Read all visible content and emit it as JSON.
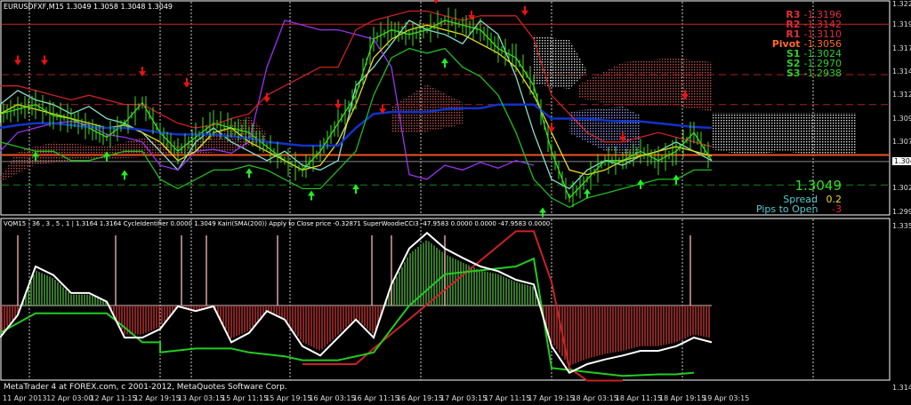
{
  "header": {
    "symbol_info": "EURUSDFXF,M15  1.3049 1.3058 1.3048 1.3049",
    "indicator_info": "VQM15 : 36 , 3 , 5 , 1  |  1.3164 1.3164  CycleIdentifier 0.0000 1.3049  Kairi(SMA(200)) Apply to Close price -0.32871  SuperWoodieCCI3 -47.9583 0.0000 0.0000 -47.9583 0.0000"
  },
  "pivots": [
    {
      "name": "R3",
      "value": "-1.3196",
      "color": "#e0303a"
    },
    {
      "name": "R2",
      "value": "-1.3142",
      "color": "#e0303a"
    },
    {
      "name": "R1",
      "value": "-1.3110",
      "color": "#e0303a"
    },
    {
      "name": "Pivot",
      "value": "-1.3056",
      "color": "#ff6a2a"
    },
    {
      "name": "S1",
      "value": "-1.3024",
      "color": "#2ecc2e"
    },
    {
      "name": "S2",
      "value": "-1.2970",
      "color": "#2ecc2e"
    },
    {
      "name": "S3",
      "value": "-1.2938",
      "color": "#2ecc2e"
    }
  ],
  "info_panel": {
    "price": "1.3049",
    "spread_label": "Spread",
    "spread_value": "0.2",
    "pips_label": "Pips to Open",
    "pips_value": "-3"
  },
  "footer": {
    "copyright": "MetaTrader 4 at FOREX.com, c 2001-2012, MetaQuotes Software Corp."
  },
  "chart_data": [
    {
      "type": "line",
      "title": "EURUSDFXF,M15",
      "ylim": [
        1.2995,
        1.322
      ],
      "y_ticks": [
        "1.3220",
        "1.3195",
        "1.3170",
        "1.3145",
        "1.3120",
        "1.3095",
        "1.3070",
        "1.3049",
        "1.3020",
        "1.2995"
      ],
      "current_price": 1.3049,
      "levels": {
        "R3": 1.3196,
        "R2": 1.3142,
        "R1": 1.311,
        "Pivot": 1.3056,
        "S1": 1.3024
      },
      "series": [
        {
          "name": "price",
          "color": "#33dd22",
          "values": [
            1.31,
            1.3105,
            1.311,
            1.3098,
            1.3095,
            1.3085,
            1.3075,
            1.309,
            1.3112,
            1.308,
            1.306,
            1.3075,
            1.309,
            1.3085,
            1.308,
            1.3065,
            1.305,
            1.304,
            1.306,
            1.309,
            1.312,
            1.318,
            1.319,
            1.3185,
            1.319,
            1.32,
            1.3195,
            1.319,
            1.317,
            1.316,
            1.313,
            1.306,
            1.301,
            1.303,
            1.305,
            1.305,
            1.306,
            1.305,
            1.306,
            1.308,
            1.305
          ]
        },
        {
          "name": "cyan",
          "color": "#88e0d0",
          "values": [
            1.311,
            1.3125,
            1.3115,
            1.311,
            1.31,
            1.3108,
            1.3095,
            1.309,
            1.308,
            1.306,
            1.304,
            1.307,
            1.3085,
            1.307,
            1.306,
            1.305,
            1.306,
            1.3045,
            1.304,
            1.305,
            1.313,
            1.315,
            1.3175,
            1.32,
            1.319,
            1.3185,
            1.3175,
            1.32,
            1.3185,
            1.314,
            1.308,
            1.303,
            1.302,
            1.304,
            1.305,
            1.3045,
            1.3055,
            1.306,
            1.307,
            1.306,
            1.305
          ]
        },
        {
          "name": "purple",
          "color": "#9933ee",
          "values": [
            1.306,
            1.308,
            1.3085,
            1.309,
            1.3092,
            1.3088,
            1.3078,
            1.3075,
            1.307,
            1.3045,
            1.304,
            1.306,
            1.3062,
            1.3058,
            1.307,
            1.315,
            1.32,
            1.3195,
            1.319,
            1.319,
            1.3185,
            1.318,
            1.315,
            1.3035,
            1.303,
            1.3045,
            1.304,
            1.3048,
            1.3042,
            1.305,
            1.3045,
            null,
            null,
            null,
            null,
            null,
            null,
            null,
            null,
            null,
            null
          ]
        },
        {
          "name": "yellow",
          "color": "#eedd22",
          "values": [
            1.31,
            1.311,
            1.3105,
            1.31,
            1.3095,
            1.309,
            1.3085,
            1.3088,
            1.308,
            1.307,
            1.305,
            1.306,
            1.308,
            1.3085,
            1.307,
            1.306,
            1.305,
            1.304,
            1.3045,
            1.307,
            1.311,
            1.316,
            1.318,
            1.319,
            1.3195,
            1.319,
            1.3185,
            1.3175,
            1.3165,
            1.315,
            1.312,
            1.308,
            1.304,
            1.3035,
            1.304,
            1.305,
            1.3055,
            1.306,
            1.3065,
            1.306,
            1.3055
          ]
        },
        {
          "name": "blue",
          "color": "#1133cc",
          "values": [
            1.3085,
            1.3088,
            1.309,
            1.309,
            1.3088,
            1.3086,
            1.3085,
            1.3085,
            1.3083,
            1.308,
            1.3078,
            1.3078,
            1.3078,
            1.3076,
            1.3074,
            1.307,
            1.3068,
            1.3066,
            1.3066,
            1.3066,
            1.3085,
            1.31,
            1.3102,
            1.3102,
            1.3102,
            1.3105,
            1.3106,
            1.3106,
            1.311,
            1.311,
            1.311,
            1.3095,
            1.3095,
            1.3095,
            1.3093,
            1.3092,
            1.3092,
            1.309,
            1.3088,
            1.3086,
            1.3085
          ]
        },
        {
          "name": "red-channel",
          "color": "#cc2222",
          "values": [
            1.313,
            1.313,
            1.3125,
            1.312,
            1.3115,
            1.312,
            1.3115,
            1.311,
            1.311,
            1.31,
            1.309,
            1.3085,
            1.3088,
            1.3095,
            1.31,
            1.312,
            1.313,
            1.314,
            1.315,
            1.315,
            1.319,
            1.32,
            1.3205,
            1.321,
            1.321,
            1.3205,
            1.32,
            1.3205,
            1.3205,
            1.3205,
            1.318,
            1.312,
            1.31,
            1.308,
            1.307,
            1.307,
            1.3075,
            1.308,
            1.3075,
            1.307,
            1.3065
          ]
        },
        {
          "name": "green-channel",
          "color": "#22bb22",
          "values": [
            1.307,
            1.3065,
            1.306,
            1.306,
            1.305,
            1.305,
            1.3055,
            1.306,
            1.306,
            1.303,
            1.302,
            1.303,
            1.304,
            1.304,
            1.3045,
            1.304,
            1.303,
            1.302,
            1.302,
            1.304,
            1.306,
            1.312,
            1.316,
            1.317,
            1.3165,
            1.317,
            1.315,
            1.314,
            1.312,
            1.308,
            1.303,
            1.301,
            1.3,
            1.301,
            1.3015,
            1.302,
            1.3025,
            1.303,
            1.303,
            1.304,
            1.304
          ]
        }
      ],
      "down_arrows": [
        [
          1,
          1.3152
        ],
        [
          2.5,
          1.3152
        ],
        [
          8,
          1.314
        ],
        [
          10.5,
          1.3128
        ],
        [
          15,
          1.3112
        ],
        [
          19,
          1.3105
        ],
        [
          21.5,
          1.31
        ],
        [
          24.5,
          1.3218
        ],
        [
          26.5,
          1.32
        ],
        [
          29.5,
          1.3205
        ],
        [
          31,
          1.308
        ],
        [
          35,
          1.307
        ],
        [
          38.5,
          1.3115
        ]
      ],
      "up_arrows": [
        [
          2,
          1.306
        ],
        [
          6,
          1.306
        ],
        [
          7,
          1.304
        ],
        [
          14,
          1.3042
        ],
        [
          17.5,
          1.3018
        ],
        [
          20,
          1.3025
        ],
        [
          25,
          1.316
        ],
        [
          30.5,
          1.3
        ],
        [
          33,
          1.302
        ],
        [
          36,
          1.303
        ],
        [
          38,
          1.3035
        ]
      ]
    },
    {
      "type": "bar",
      "title": "VQM15 / CycleIdentifier / Kairi / SuperWoodieCCI3",
      "y_ticks": [
        "1.3352",
        "1.3141"
      ],
      "ylim": [
        -95,
        105
      ],
      "histogram": [
        -37,
        -11,
        45,
        35,
        14,
        14,
        5,
        -37,
        -37,
        -27,
        -1,
        -6,
        -1,
        -42,
        -32,
        -6,
        -16,
        -47,
        -58,
        -37,
        -16,
        -37,
        24,
        66,
        84,
        66,
        55,
        45,
        40,
        30,
        24,
        -47,
        -77,
        -68,
        -62,
        -58,
        -52,
        -52,
        -47,
        -37,
        -42
      ],
      "white_line": [
        -41,
        -12,
        50,
        39,
        16,
        16,
        5,
        -41,
        -41,
        -30,
        -1,
        -7,
        -1,
        -47,
        -35,
        -7,
        -18,
        -52,
        -64,
        -41,
        -18,
        -41,
        27,
        73,
        93,
        73,
        61,
        50,
        44,
        33,
        27,
        -52,
        -86,
        -75,
        -69,
        -64,
        -58,
        -58,
        -52,
        -41,
        -47
      ],
      "green_step": [
        [
          0,
          -35
        ],
        [
          2,
          -10
        ],
        [
          4,
          -10
        ],
        [
          6,
          -10
        ],
        [
          7,
          -28
        ],
        [
          8,
          -47
        ],
        [
          9,
          -47
        ],
        [
          9,
          -60
        ],
        [
          11,
          -55
        ],
        [
          12,
          -55
        ],
        [
          13,
          -55
        ],
        [
          14,
          -60
        ],
        [
          16,
          -65
        ],
        [
          17,
          -70
        ],
        [
          19,
          -70
        ],
        [
          21,
          -60
        ],
        [
          22,
          -30
        ],
        [
          23,
          0
        ],
        [
          25,
          40
        ],
        [
          27,
          45
        ],
        [
          29,
          50
        ],
        [
          30,
          60
        ],
        [
          31,
          -80
        ],
        [
          35,
          -90
        ],
        [
          37,
          -88
        ],
        [
          38,
          -88
        ],
        [
          39,
          -86
        ]
      ],
      "red_step": [
        [
          17,
          -75
        ],
        [
          20,
          -75
        ],
        [
          21,
          -55
        ],
        [
          29,
          95
        ],
        [
          30,
          95
        ],
        [
          31,
          30
        ],
        [
          32,
          -80
        ],
        [
          33,
          -96
        ],
        [
          35,
          -96
        ]
      ],
      "spikes": [
        1,
        6.5,
        10.2,
        11.6,
        15.6,
        20.9,
        22,
        25,
        38.8
      ]
    }
  ],
  "time_axis": [
    "11 Apr 2013",
    "12 Apr 03:00",
    "12 Apr 11:15",
    "12 Apr 19:15",
    "13 Apr 03:15",
    "15 Apr 11:15",
    "15 Apr 19:15",
    "16 Apr 03:15",
    "16 Apr 11:15",
    "16 Apr 19:15",
    "17 Apr 03:15",
    "17 Apr 11:15",
    "17 Apr 19:15",
    "18 Apr 03:15",
    "18 Apr 11:15",
    "18 Apr 19:15",
    "19 Apr 03:15"
  ]
}
